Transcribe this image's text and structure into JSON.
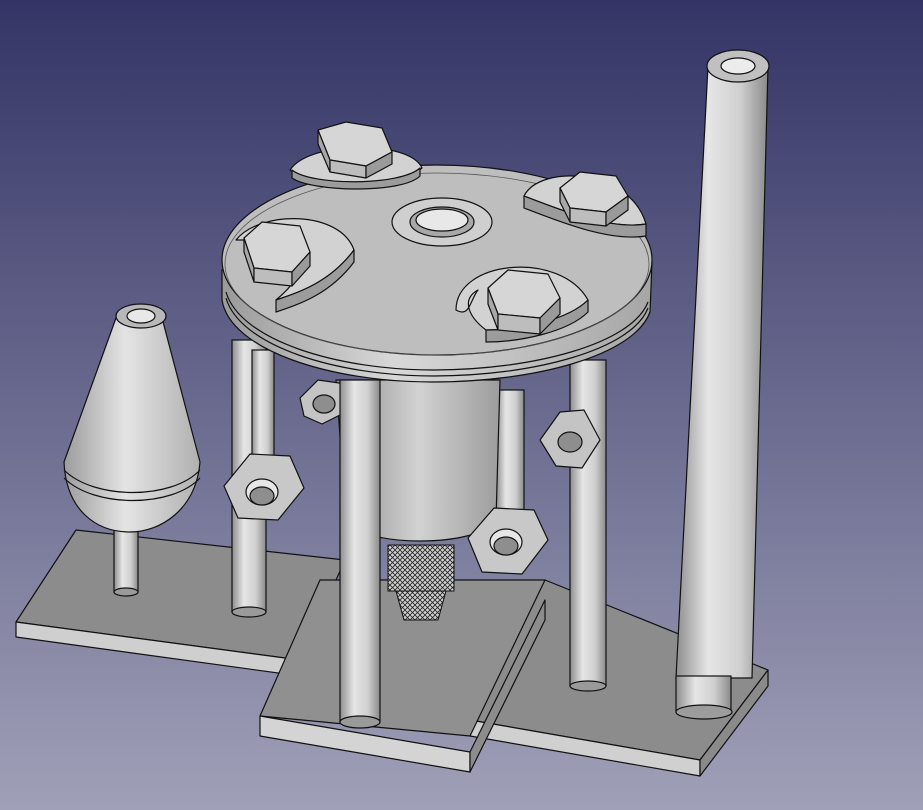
{
  "viewport": {
    "background_top": "#343466",
    "background_bottom": "#a0a0b8"
  },
  "model": {
    "part_color": "#c8c8c8",
    "edge_color": "#111111",
    "parts": [
      "plate-left",
      "plate-center",
      "plate-right",
      "round-flange",
      "cone-weight",
      "tall-tube",
      "support-rods",
      "hex-nuts",
      "cap-bolts",
      "knurled-shaft"
    ]
  }
}
